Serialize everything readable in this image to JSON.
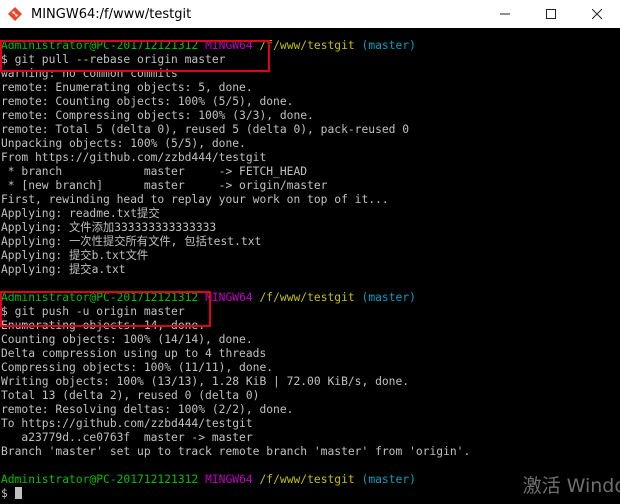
{
  "window": {
    "title": "MINGW64:/f/www/testgit",
    "controls": [
      "minimize",
      "maximize",
      "close"
    ]
  },
  "prompts": [
    {
      "user": "Administrator@PC-201712121312",
      "system": "MINGW64",
      "path": "/f/www/testgit",
      "branch": "(master)"
    },
    {
      "user": "Administrator@PC-201712121312",
      "system": "MINGW64",
      "path": "/f/www/testgit",
      "branch": "(master)"
    },
    {
      "user": "Administrator@PC-201712121312",
      "system": "MINGW64",
      "path": "/f/www/testgit",
      "branch": "(master)"
    }
  ],
  "commands": [
    "$ git pull --rebase origin master",
    "$ git push -u origin master",
    "$ "
  ],
  "output_pull": [
    "warning: no common commits",
    "remote: Enumerating objects: 5, done.",
    "remote: Counting objects: 100% (5/5), done.",
    "remote: Compressing objects: 100% (3/3), done.",
    "remote: Total 5 (delta 0), reused 5 (delta 0), pack-reused 0",
    "Unpacking objects: 100% (5/5), done.",
    "From https://github.com/zzbd444/testgit",
    " * branch            master     -> FETCH_HEAD",
    " * [new branch]      master     -> origin/master",
    "First, rewinding head to replay your work on top of it...",
    "Applying: readme.txt提交",
    "Applying: 文件添加333333333333333",
    "Applying: 一次性提交所有文件, 包括test.txt",
    "Applying: 提交b.txt文件",
    "Applying: 提交a.txt"
  ],
  "output_push": [
    "Enumerating objects: 14, done.",
    "Counting objects: 100% (14/14), done.",
    "Delta compression using up to 4 threads",
    "Compressing objects: 100% (11/11), done.",
    "Writing objects: 100% (13/13), 1.28 KiB | 72.00 KiB/s, done.",
    "Total 13 (delta 2), reused 0 (delta 0)",
    "remote: Resolving deltas: 100% (2/2), done.",
    "To https://github.com/zzbd444/testgit",
    "   a23779d..ce0763f  master -> master",
    "Branch 'master' set up to track remote branch 'master' from 'origin'."
  ],
  "watermark": "激活 Windo",
  "colors": {
    "background": "#000000",
    "text": "#c0c0c0",
    "prompt_user": "#00c000",
    "prompt_system": "#c000c0",
    "prompt_path": "#c0c000",
    "prompt_branch": "#00a0c0",
    "highlight_box": "#e0001a"
  }
}
